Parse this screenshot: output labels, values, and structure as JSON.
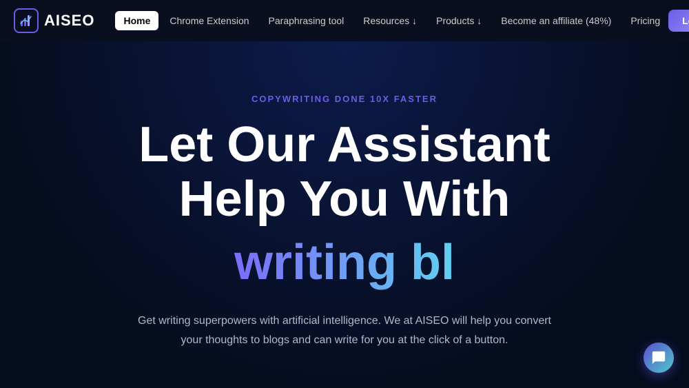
{
  "nav": {
    "logo_text": "AISEO",
    "links": [
      {
        "id": "home",
        "label": "Home",
        "active": true
      },
      {
        "id": "chrome-extension",
        "label": "Chrome Extension",
        "active": false
      },
      {
        "id": "paraphrasing-tool",
        "label": "Paraphrasing tool",
        "active": false
      },
      {
        "id": "resources",
        "label": "Resources ↓",
        "active": false
      },
      {
        "id": "products",
        "label": "Products ↓",
        "active": false
      },
      {
        "id": "affiliate",
        "label": "Become an affiliate (48%)",
        "active": false
      },
      {
        "id": "pricing",
        "label": "Pricing",
        "active": false
      }
    ],
    "login_label": "Login"
  },
  "hero": {
    "tagline": "COPYWRITING DONE 10X FASTER",
    "title_line1": "Let Our Assistant",
    "title_line2": "Help You With",
    "animated_text": "writing bl",
    "description": "Get writing superpowers with artificial intelligence. We at AISEO will help you convert your thoughts to blogs and can write for you at the click of a button."
  },
  "colors": {
    "accent_purple": "#6c5ce7",
    "accent_cyan": "#60d0f0",
    "gradient_start": "#7c6cfa",
    "gradient_end": "#60d0f0"
  }
}
